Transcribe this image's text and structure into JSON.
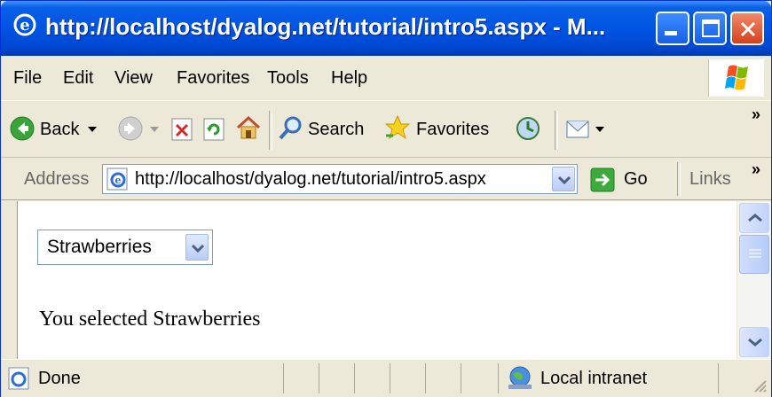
{
  "window": {
    "title": "http://localhost/dyalog.net/tutorial/intro5.aspx - M...",
    "minimize_icon": "minimize-icon",
    "maximize_icon": "maximize-icon",
    "close_icon": "close-icon"
  },
  "menu": {
    "items": [
      "File",
      "Edit",
      "View",
      "Favorites",
      "Tools",
      "Help"
    ]
  },
  "toolbar": {
    "back_label": "Back",
    "search_label": "Search",
    "favorites_label": "Favorites",
    "overflow": "»"
  },
  "address": {
    "label": "Address",
    "url": "http://localhost/dyalog.net/tutorial/intro5.aspx",
    "go_label": "Go",
    "links_label": "Links",
    "overflow": "»"
  },
  "page": {
    "select_value": "Strawberries",
    "result_text": "You selected Strawberries"
  },
  "status": {
    "text": "Done",
    "zone": "Local intranet"
  }
}
